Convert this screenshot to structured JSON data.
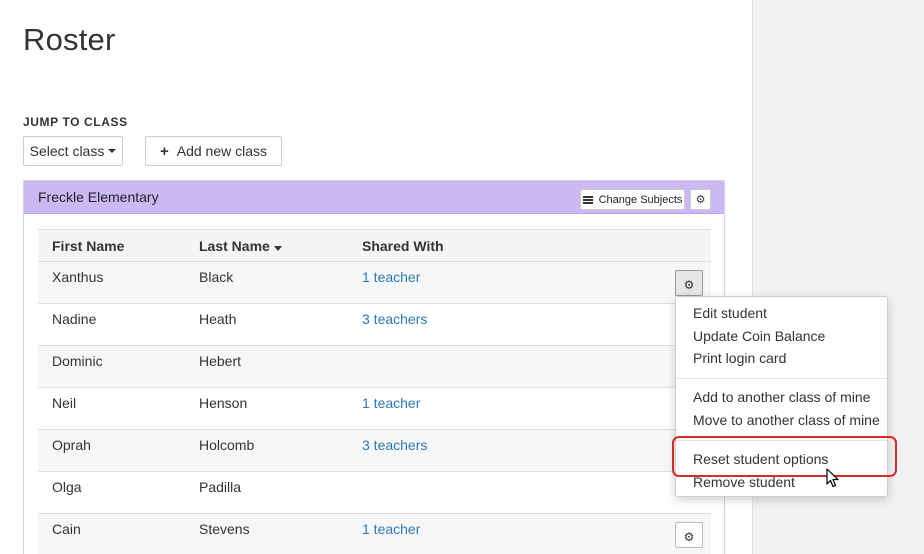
{
  "page": {
    "title": "Roster"
  },
  "jump": {
    "label": "JUMP TO CLASS",
    "select_label": "Select class",
    "add_label": "Add new class"
  },
  "class_panel": {
    "name": "Freckle Elementary",
    "change_subjects_label": "Change Subjects",
    "header_color": "#cbb8f5"
  },
  "table": {
    "headers": {
      "first": "First Name",
      "last": "Last Name",
      "shared": "Shared With"
    },
    "sorted_by": "Last Name",
    "rows": [
      {
        "first": "Xanthus",
        "last": "Black",
        "shared": "1 teacher"
      },
      {
        "first": "Nadine",
        "last": "Heath",
        "shared": "3 teachers"
      },
      {
        "first": "Dominic",
        "last": "Hebert",
        "shared": ""
      },
      {
        "first": "Neil",
        "last": "Henson",
        "shared": "1 teacher"
      },
      {
        "first": "Oprah",
        "last": "Holcomb",
        "shared": "3 teachers"
      },
      {
        "first": "Olga",
        "last": "Padilla",
        "shared": ""
      },
      {
        "first": "Cain",
        "last": "Stevens",
        "shared": "1 teacher"
      }
    ]
  },
  "dropdown": {
    "items": [
      "Edit student",
      "Update Coin Balance",
      "Print login card",
      "Add to another class of mine",
      "Move to another class of mine",
      "Reset student options",
      "Remove student"
    ],
    "highlighted_item": "Reset student options",
    "highlight_color": "#d92a2a"
  },
  "icons": {
    "gear": "gear-icon",
    "list": "list-icon",
    "plus": "plus-icon",
    "cursor": "mouse-pointer-icon"
  },
  "colors": {
    "link": "#2a7ab8",
    "right_panel": "#f2f2f2"
  }
}
